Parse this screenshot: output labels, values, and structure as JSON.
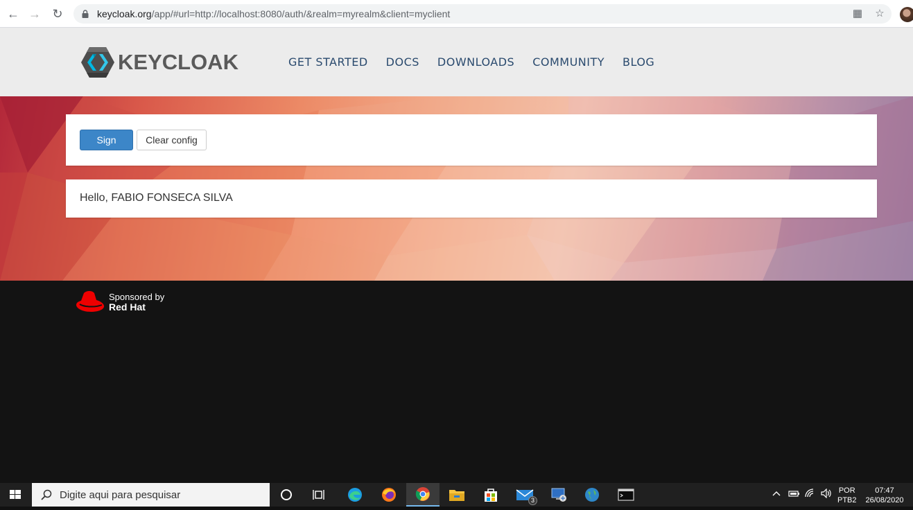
{
  "browser": {
    "url_domain": "keycloak.org",
    "url_path": "/app/#url=http://localhost:8080/auth/&realm=myrealm&client=myclient"
  },
  "site": {
    "logo_text": "KEYCLOAK",
    "nav": [
      "GET STARTED",
      "DOCS",
      "DOWNLOADS",
      "COMMUNITY",
      "BLOG"
    ]
  },
  "app": {
    "sign_out_label": "Sign out",
    "clear_config_label": "Clear config",
    "greeting": "Hello, FABIO FONSECA SILVA"
  },
  "footer": {
    "sponsored_by": "Sponsored by",
    "sponsor_name": "Red Hat"
  },
  "taskbar": {
    "search_placeholder": "Digite aqui para pesquisar",
    "mail_badge": "3",
    "lang_top": "POR",
    "lang_bottom": "PTB2",
    "time": "07:47",
    "date": "26/08/2020"
  },
  "colors": {
    "primary_button": "#3c86c8",
    "nav_link": "#2a4a6e",
    "footer_bg": "#131313"
  }
}
